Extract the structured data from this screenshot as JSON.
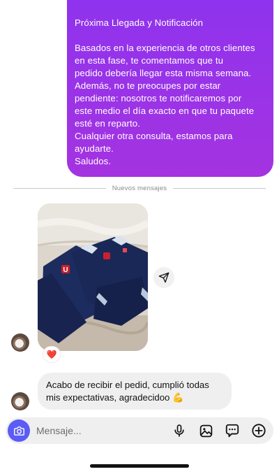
{
  "outgoing_message": {
    "lines": [
      "Próxima Llegada y Notificación",
      "",
      "Basados en la experiencia de otros clientes",
      "en esta fase, te comentamos que tu",
      "pedido debería llegar esta misma semana.",
      "Además, no te preocupes por estar",
      "pendiente: nosotros te notificaremos por",
      "este medio el día exacto en que tu paquete",
      "esté en reparto.",
      "Cualquier otra consulta, estamos para",
      "ayudarte.",
      "Saludos."
    ]
  },
  "divider": {
    "label": "Nuevos mensajes"
  },
  "photo_message": {
    "reaction": "❤️"
  },
  "incoming_message": {
    "lines": [
      "Acabo de recibir el pedid, cumplió todas",
      "mis expectativas, agradecidoo 💪"
    ]
  },
  "composer": {
    "placeholder": "Mensaje..."
  },
  "icons": {
    "camera": "camera-icon",
    "share": "send-icon",
    "microphone": "microphone-icon",
    "gallery": "gallery-icon",
    "sticker": "sticker-icon",
    "add": "plus-icon"
  },
  "colors": {
    "outgoing_bubble": "#9333ea",
    "incoming_bubble": "#efefef",
    "camera_button": "#5b5bf5",
    "reaction_heart": "#e5203c"
  }
}
